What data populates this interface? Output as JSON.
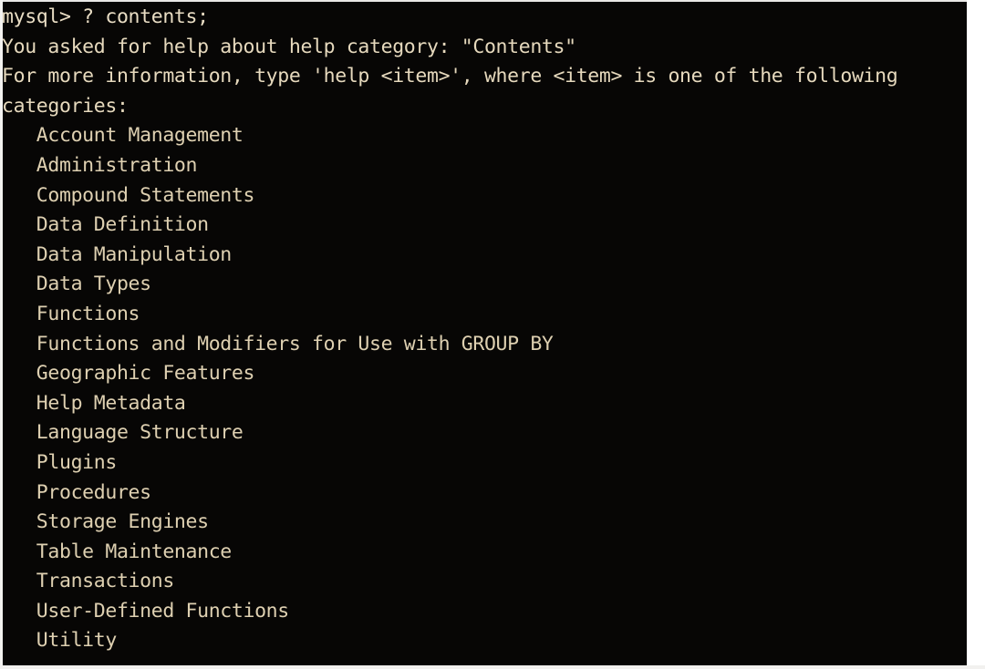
{
  "terminal": {
    "app": "mysql-client",
    "background_color": "#070605",
    "text_color": "#e6d9bd",
    "prompt": "mysql>",
    "command_line": "mysql> ? contents;",
    "output_lines": [
      "You asked for help about help category: \"Contents\"",
      "For more information, type 'help <item>', where <item> is one of the following",
      "categories:"
    ],
    "categories": [
      "Account Management",
      "Administration",
      "Compound Statements",
      "Data Definition",
      "Data Manipulation",
      "Data Types",
      "Functions",
      "Functions and Modifiers for Use with GROUP BY",
      "Geographic Features",
      "Help Metadata",
      "Language Structure",
      "Plugins",
      "Procedures",
      "Storage Engines",
      "Table Maintenance",
      "Transactions",
      "User-Defined Functions",
      "Utility"
    ],
    "category_indent": "   "
  }
}
